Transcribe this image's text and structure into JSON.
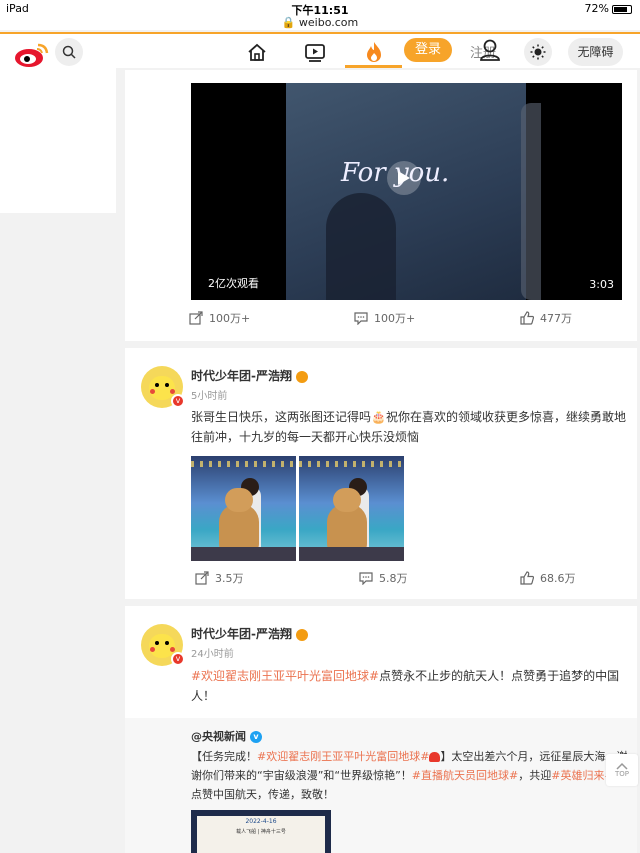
{
  "status_bar": {
    "device": "iPad",
    "time": "下午11:51",
    "url": "weibo.com",
    "battery": "72%",
    "battery_level": 0.72
  },
  "nav": {
    "login_label": "登录",
    "register_label": "注册",
    "accessibility_label": "无障碍",
    "active_tab": "hot"
  },
  "video_post": {
    "overlay_text": "For you.",
    "views": "2亿次观看",
    "duration": "3:03",
    "reposts": "100万+",
    "comments": "100万+",
    "likes": "477万"
  },
  "post2": {
    "user": "时代少年团-严浩翔",
    "time": "5小时前",
    "text": "张哥生日快乐，这两张图还记得吗🎂祝你在喜欢的领域收获更多惊喜，继续勇敢地往前冲，十九岁的每一天都开心快乐没烦恼",
    "reposts": "3.5万",
    "comments": "5.8万",
    "likes": "68.6万"
  },
  "post3": {
    "user": "时代少年团-严浩翔",
    "time": "24小时前",
    "topic": "#欢迎翟志刚王亚平叶光富回地球#",
    "text_after": "点赞永不止步的航天人！点赞勇于追梦的中国人！",
    "repost": {
      "user": "@央视新闻",
      "text_prefix": "【任务完成！",
      "topic1": "#欢迎翟志刚王亚平叶光富回地球#",
      "text_mid1": "】太空出差六个月，远征星辰大海。谢谢你们带来的“宇宙级浪漫”和“世界级惊艳”！",
      "topic2": "#直播航天员回地球#",
      "text_mid2": "，共迎",
      "topic3": "#英雄归来#",
      "text_end": "，点赞中国航天，传递，致敬！",
      "image_date": "2022-4-16",
      "image_sub": "载人飞船 | 神舟十三号"
    }
  },
  "top_button": "TOP"
}
